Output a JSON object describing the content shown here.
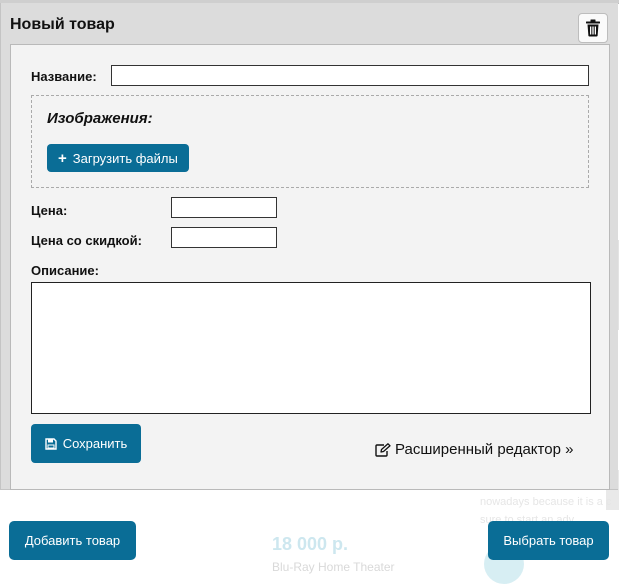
{
  "panel": {
    "title": "Новый товар",
    "trash_icon": "trash-icon"
  },
  "form": {
    "name_label": "Название:",
    "name_value": "",
    "images": {
      "title": "Изображения:",
      "upload_label": "Загрузить файлы",
      "upload_icon": "plus-icon"
    },
    "price_label": "Цена:",
    "price_value": "",
    "discount_label": "Цена со скидкой:",
    "discount_value": "",
    "description_label": "Описание:",
    "description_value": "",
    "save_label": "Сохранить",
    "save_icon": "floppy-disk-icon",
    "advanced_label": "Расширенный редактор »",
    "advanced_icon": "edit-icon"
  },
  "actions": {
    "add_product": "Добавить товар",
    "choose_product": "Выбрать товар"
  },
  "background": {
    "price": "18 000 р.",
    "product_name": "Blu-Ray Home Theater",
    "snippet_line1": "nowadays because it is a c",
    "snippet_line2": "sure to start an adv"
  },
  "colors": {
    "accent": "#0a6d96",
    "panel_bg": "#dcdcdc",
    "form_bg": "#f3f3f3"
  }
}
